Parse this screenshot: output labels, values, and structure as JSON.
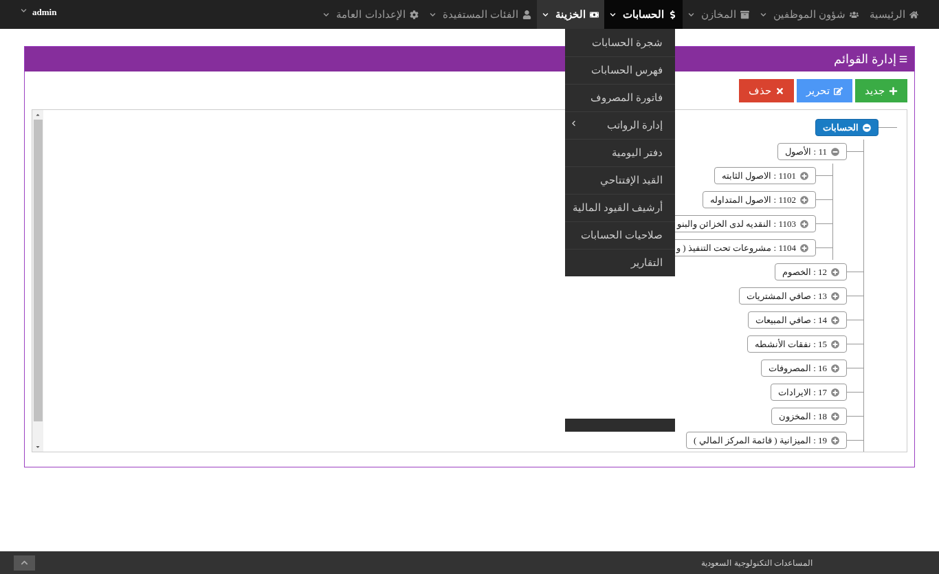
{
  "navbar": {
    "items": [
      {
        "label": "الرئيسية",
        "selected": false,
        "hovered": false,
        "has_caret": false
      },
      {
        "label": "شؤون الموظفين",
        "selected": false,
        "hovered": false,
        "has_caret": true
      },
      {
        "label": "المخازن",
        "selected": false,
        "hovered": false,
        "has_caret": true
      },
      {
        "label": "الحسابات",
        "selected": true,
        "hovered": false,
        "has_caret": true
      },
      {
        "label": "الخزينة",
        "selected": false,
        "hovered": true,
        "has_caret": true
      },
      {
        "label": "الفئات المستفيدة",
        "selected": false,
        "hovered": false,
        "has_caret": true
      },
      {
        "label": "الإعدادات العامة",
        "selected": false,
        "hovered": false,
        "has_caret": true
      }
    ],
    "user": "admin"
  },
  "dropdown": {
    "items": [
      {
        "label": "شجرة الحسابات",
        "has_submenu": false
      },
      {
        "label": "فهرس الحسابات",
        "has_submenu": false
      },
      {
        "label": "فاتورة المصروف",
        "has_submenu": false
      },
      {
        "label": "إدارة الرواتب",
        "has_submenu": true
      },
      {
        "label": "دفتر اليومية",
        "has_submenu": false
      },
      {
        "label": "القيد الإفتتاحي",
        "has_submenu": false
      },
      {
        "label": "أرشيف القيود المالية",
        "has_submenu": false
      },
      {
        "label": "صلاحيات الحسابات",
        "has_submenu": false
      },
      {
        "label": "التقارير",
        "has_submenu": false
      }
    ]
  },
  "panel": {
    "title": "إدارة القوائم",
    "buttons": [
      {
        "label": "جديد",
        "kind": "new"
      },
      {
        "label": "تحرير",
        "kind": "edit"
      },
      {
        "label": "حذف",
        "kind": "delete"
      }
    ],
    "tree": [
      {
        "label": "الحسابات",
        "selected": true,
        "expanded": true,
        "children": [
          {
            "label": "11 : الأصول",
            "selected": false,
            "expanded": true,
            "children": [
              {
                "label": "1101 : الاصول الثابته",
                "selected": false,
                "expanded": false
              },
              {
                "label": "1102 : الاصول المتداوله",
                "selected": false,
                "expanded": false
              },
              {
                "label": "1103 : النقديه لدى الخزائن والبنو",
                "selected": false,
                "expanded": false
              },
              {
                "label": "1104 : مشروعات تحت التنفيذ ( و",
                "selected": false,
                "expanded": false
              }
            ]
          },
          {
            "label": "12 : الخصوم",
            "selected": false,
            "expanded": false
          },
          {
            "label": "13 : صافي المشتريات",
            "selected": false,
            "expanded": false
          },
          {
            "label": "14 : صافي المبيعات",
            "selected": false,
            "expanded": false
          },
          {
            "label": "15 : نفقات الأنشطه",
            "selected": false,
            "expanded": false
          },
          {
            "label": "16 : المصروفات",
            "selected": false,
            "expanded": false
          },
          {
            "label": "17 : الايرادات",
            "selected": false,
            "expanded": false
          },
          {
            "label": "18 : المخزون",
            "selected": false,
            "expanded": false
          },
          {
            "label": "19 : الميزانية ( قائمة المركز المالي )",
            "selected": false,
            "expanded": false
          }
        ]
      }
    ]
  },
  "footer": {
    "text": "المساعدات التكنولوجية السعودية"
  }
}
